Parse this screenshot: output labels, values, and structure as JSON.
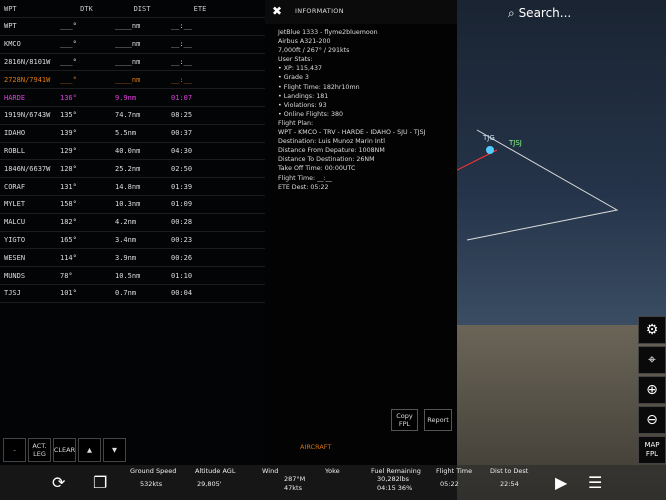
{
  "flight_plan": {
    "headers": [
      "WPT",
      "DTK",
      "DIST",
      "ETE"
    ],
    "rows": [
      {
        "wpt": "WPT",
        "dtk": "___°",
        "dist": "____nm",
        "ete": "__:__",
        "state": ""
      },
      {
        "wpt": "KMCO",
        "dtk": "___°",
        "dist": "____nm",
        "ete": "__:__",
        "state": ""
      },
      {
        "wpt": "2816N/8101W",
        "dtk": "___°",
        "dist": "____nm",
        "ete": "__:__",
        "state": ""
      },
      {
        "wpt": "2728N/7941W",
        "dtk": "___°",
        "dist": "____nm",
        "ete": "__:__",
        "state": "prev"
      },
      {
        "wpt": "HARDE",
        "dtk": "136°",
        "dist": "9.9nm",
        "ete": "01:07",
        "state": "active"
      },
      {
        "wpt": "1919N/6743W",
        "dtk": "135°",
        "dist": "74.7nm",
        "ete": "08:25",
        "state": ""
      },
      {
        "wpt": "IDAHO",
        "dtk": "139°",
        "dist": "5.5nm",
        "ete": "00:37",
        "state": ""
      },
      {
        "wpt": "ROBLL",
        "dtk": "129°",
        "dist": "40.0nm",
        "ete": "04:30",
        "state": ""
      },
      {
        "wpt": "1846N/6637W",
        "dtk": "128°",
        "dist": "25.2nm",
        "ete": "02:50",
        "state": ""
      },
      {
        "wpt": "CORAF",
        "dtk": "131°",
        "dist": "14.8nm",
        "ete": "01:39",
        "state": ""
      },
      {
        "wpt": "MYLET",
        "dtk": "158°",
        "dist": "10.3nm",
        "ete": "01:09",
        "state": ""
      },
      {
        "wpt": "MALCU",
        "dtk": "182°",
        "dist": "4.2nm",
        "ete": "00:28",
        "state": ""
      },
      {
        "wpt": "YIGTO",
        "dtk": "165°",
        "dist": "3.4nm",
        "ete": "00:23",
        "state": ""
      },
      {
        "wpt": "WESEN",
        "dtk": "114°",
        "dist": "3.9nm",
        "ete": "00:26",
        "state": ""
      },
      {
        "wpt": "MUNDS",
        "dtk": "78°",
        "dist": "10.5nm",
        "ete": "01:10",
        "state": ""
      },
      {
        "wpt": "TJSJ",
        "dtk": "101°",
        "dist": "0.7nm",
        "ete": "00:04",
        "state": ""
      }
    ],
    "buttons": {
      "dot": "-",
      "act_leg": "ACT. LEG",
      "clear": "CLEAR"
    }
  },
  "info": {
    "title": "INFORMATION",
    "lines": [
      "JetBlue 1333 - flyme2bluemoon",
      "Airbus A321-200",
      "7,000ft / 267° / 291kts",
      "User Stats:",
      "• XP: 115,437",
      "• Grade 3",
      "• Flight Time: 182hr10mn",
      "• Landings: 181",
      "• Violations: 93",
      "• Online Flights: 380",
      "Flight Plan:",
      "WPT - KMCO - TRV - HARDE - IDAHO - SJU - TJSJ",
      "Destination: Luis Munoz Marin Intl",
      "Distance From Depature: 1008NM",
      "Distance To Destination: 26NM",
      "Take Off Time: 00:00UTC",
      "Flight Time: __:__",
      "ETE Dest: 05:22"
    ],
    "copy_fpl": "Copy FPL",
    "report": "Report",
    "aircraft_tab": "AIRCRAFT"
  },
  "search": {
    "label": "Search..."
  },
  "map_labels": [
    "TJG",
    "TJSJ"
  ],
  "right_buttons": {
    "map_fpl": "MAP FPL"
  },
  "bottom_bar": {
    "ground_speed_label": "Ground Speed",
    "ground_speed": "532kts",
    "altitude_label": "Altitude AGL",
    "altitude": "29,805'",
    "wind_label": "Wind",
    "wind_dir": "287°M",
    "wind_speed": "47kts",
    "yoke_label": "Yoke",
    "fuel_label": "Fuel Remaining",
    "fuel": "30,282lbs",
    "fuel_time": "04:15 36%",
    "flight_time_label": "Flight Time",
    "flight_time": "05:22",
    "dist_label": "Dist to Dest",
    "dist": "22:54"
  }
}
